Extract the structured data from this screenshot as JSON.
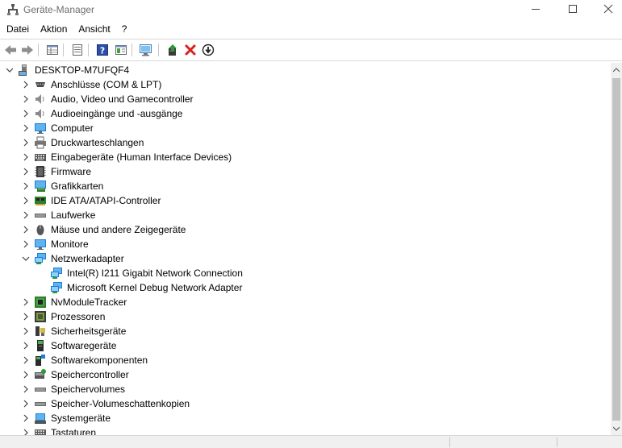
{
  "window": {
    "title": "Geräte-Manager"
  },
  "menu": [
    "Datei",
    "Aktion",
    "Ansicht",
    "?"
  ],
  "toolbar": {
    "buttons": [
      "back-arrow",
      "forward-arrow",
      "properties-grid",
      "properties-sheet",
      "help",
      "view-details",
      "monitor-scan",
      "update-driver",
      "uninstall",
      "disable"
    ]
  },
  "tree": {
    "root": "DESKTOP-M7UFQF4",
    "categories": [
      {
        "label": "Anschlüsse (COM & LPT)",
        "icon": "port-icon",
        "expanded": false
      },
      {
        "label": "Audio, Video und Gamecontroller",
        "icon": "speaker-icon",
        "expanded": false
      },
      {
        "label": "Audioeingänge und -ausgänge",
        "icon": "speaker-icon",
        "expanded": false
      },
      {
        "label": "Computer",
        "icon": "monitor-icon",
        "expanded": false
      },
      {
        "label": "Druckwarteschlangen",
        "icon": "printer-icon",
        "expanded": false
      },
      {
        "label": "Eingabegeräte (Human Interface Devices)",
        "icon": "keyboard-icon",
        "expanded": false
      },
      {
        "label": "Firmware",
        "icon": "chip-icon",
        "expanded": false
      },
      {
        "label": "Grafikkarten",
        "icon": "display-adapter-icon",
        "expanded": false
      },
      {
        "label": "IDE ATA/ATAPI-Controller",
        "icon": "ide-controller-icon",
        "expanded": false
      },
      {
        "label": "Laufwerke",
        "icon": "drive-icon",
        "expanded": false
      },
      {
        "label": "Mäuse und andere Zeigegeräte",
        "icon": "mouse-icon",
        "expanded": false
      },
      {
        "label": "Monitore",
        "icon": "monitor-icon",
        "expanded": false
      },
      {
        "label": "Netzwerkadapter",
        "icon": "network-icon",
        "expanded": true,
        "children": [
          {
            "label": "Intel(R) I211 Gigabit Network Connection",
            "icon": "network-icon"
          },
          {
            "label": "Microsoft Kernel Debug Network Adapter",
            "icon": "network-icon"
          }
        ]
      },
      {
        "label": "NvModuleTracker",
        "icon": "board-icon",
        "expanded": false
      },
      {
        "label": "Prozessoren",
        "icon": "cpu-icon",
        "expanded": false
      },
      {
        "label": "Sicherheitsgeräte",
        "icon": "security-icon",
        "expanded": false
      },
      {
        "label": "Softwaregeräte",
        "icon": "software-device-icon",
        "expanded": false
      },
      {
        "label": "Softwarekomponenten",
        "icon": "software-component-icon",
        "expanded": false
      },
      {
        "label": "Speichercontroller",
        "icon": "storage-controller-icon",
        "expanded": false
      },
      {
        "label": "Speichervolumes",
        "icon": "drive-icon",
        "expanded": false
      },
      {
        "label": "Speicher-Volumeschattenkopien",
        "icon": "drive-icon",
        "expanded": false
      },
      {
        "label": "Systemgeräte",
        "icon": "system-icon",
        "expanded": false
      },
      {
        "label": "Tastaturen",
        "icon": "keyboard-icon",
        "expanded": false
      }
    ]
  },
  "colors": {
    "accent_blue": "#1e7fd6",
    "uninstall_red": "#d9201c",
    "update_green": "#2c9a33"
  }
}
